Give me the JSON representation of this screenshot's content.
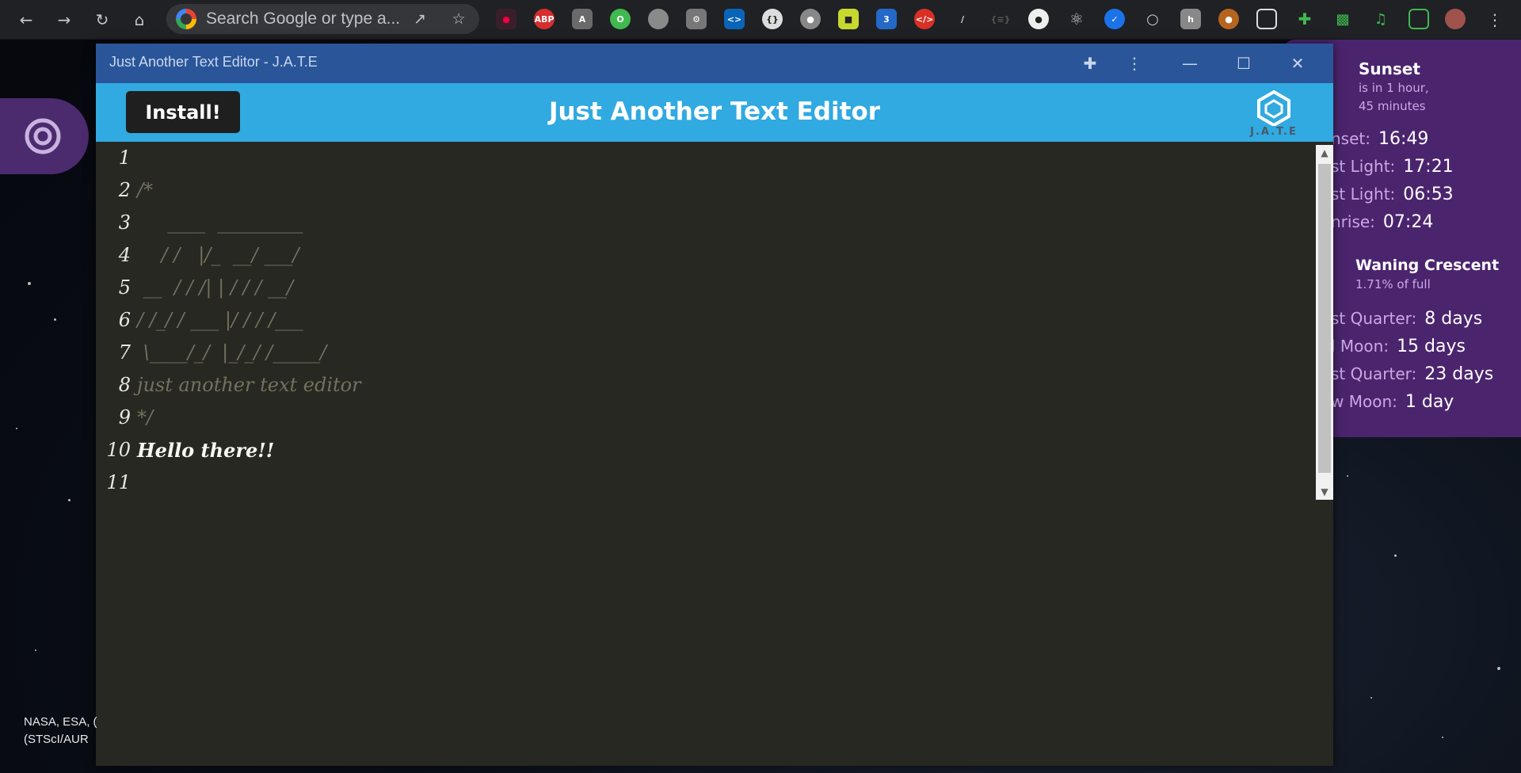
{
  "browser": {
    "omnibox_placeholder": "Search Google or type a...",
    "accent_color": "#202124"
  },
  "window": {
    "title": "Just Another Text Editor - J.A.T.E",
    "titlebar_color": "#2a5699"
  },
  "app": {
    "install_label": "Install!",
    "header_title": "Just Another Text Editor",
    "logo_text": "J.A.T.E",
    "header_color": "#31a9e1"
  },
  "editor": {
    "lines": [
      {
        "n": "1",
        "text": "",
        "kind": "txt"
      },
      {
        "n": "2",
        "text": "/*",
        "kind": "cmt"
      },
      {
        "n": "3",
        "text": "     ____  _________",
        "kind": "cmt"
      },
      {
        "n": "4",
        "text": "    / /   |/_  __/ ___/",
        "kind": "cmt"
      },
      {
        "n": "5",
        "text": " __  / / /| | / / / __/",
        "kind": "cmt"
      },
      {
        "n": "6",
        "text": "/ /_/ / ___ |/ / / /___",
        "kind": "cmt"
      },
      {
        "n": "7",
        "text": " \\____/_/  |_/_/ /_____/",
        "kind": "cmt"
      },
      {
        "n": "8",
        "text": "just another text editor",
        "kind": "cmt"
      },
      {
        "n": "9",
        "text": "*/",
        "kind": "cmt"
      },
      {
        "n": "10",
        "text": "Hello there!!",
        "kind": "txt"
      },
      {
        "n": "11",
        "text": "",
        "kind": "txt"
      }
    ]
  },
  "sun_widget": {
    "title": "Sunset",
    "subtitle_1": "is in 1 hour,",
    "subtitle_2": "45 minutes",
    "rows": [
      {
        "label": "nset:",
        "value": "16:49"
      },
      {
        "label": "st Light:",
        "value": "17:21"
      },
      {
        "label": "st Light:",
        "value": "06:53"
      },
      {
        "label": "nrise:",
        "value": "07:24"
      }
    ]
  },
  "moon_widget": {
    "title": "Waning Crescent",
    "subtitle": "1.71% of full",
    "rows": [
      {
        "label": "st Quarter:",
        "value": "8 days"
      },
      {
        "label": "l Moon:",
        "value": "15 days"
      },
      {
        "label": "st Quarter:",
        "value": "23 days"
      },
      {
        "label": "w Moon:",
        "value": "1 day"
      }
    ]
  },
  "background_credit": {
    "line1": "NASA, ESA, (",
    "line2": "(STScI/AUR"
  }
}
